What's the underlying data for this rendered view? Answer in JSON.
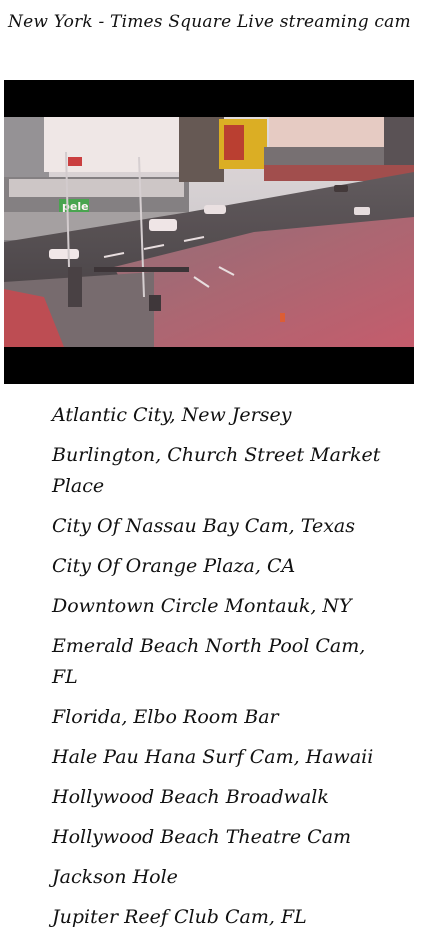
{
  "page": {
    "title": "New York - Times Square Live streaming cam"
  },
  "video": {
    "sign_text": "pele"
  },
  "camera_list": [
    "Atlantic City, New Jersey",
    "Burlington, Church Street Market Place",
    "City Of Nassau Bay Cam, Texas",
    "City Of Orange Plaza, CA",
    "Downtown Circle Montauk, NY",
    "Emerald Beach North Pool Cam, FL",
    "Florida, Elbo Room Bar",
    "Hale Pau Hana Surf Cam, Hawaii",
    "Hollywood Beach Broadwalk",
    "Hollywood Beach Theatre Cam",
    "Jackson Hole",
    "Jupiter Reef Club Cam, FL"
  ]
}
